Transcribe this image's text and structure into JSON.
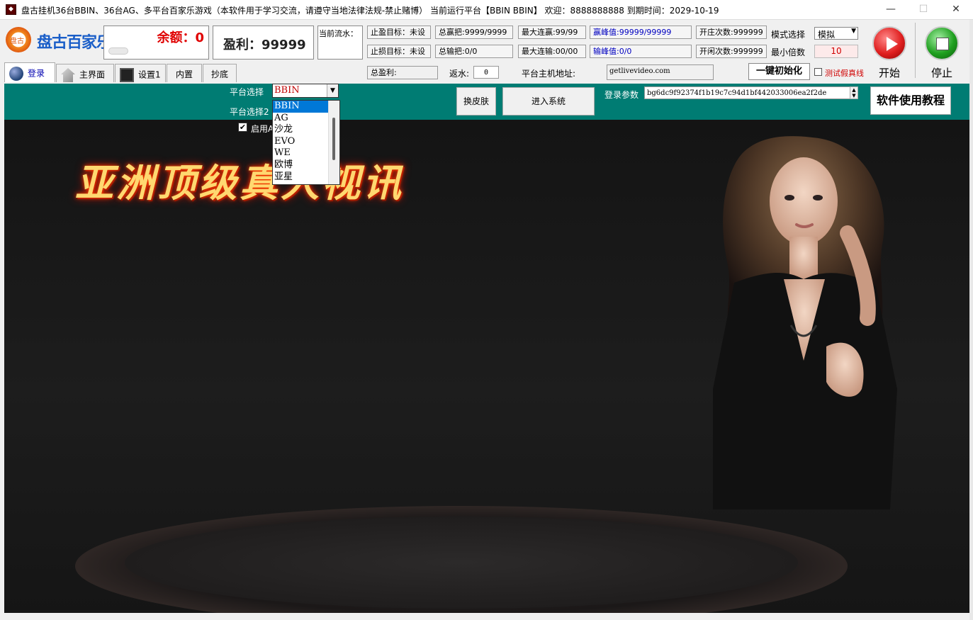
{
  "window": {
    "title": "盘古挂机36台BBIN、36台AG、多平台百家乐游戏（本软件用于学习交流，请遵守当地法律法规-禁止赌博） 当前运行平台【BBIN BBIN】 欢迎：8888888888  到期时间：2029-10-19",
    "min": "—",
    "max": "☐",
    "close": "✕"
  },
  "header": {
    "logo_text": "盘古百家乐",
    "logo_badge": "盘古",
    "balance": "余额：0",
    "profit": "盈利：99999",
    "current_flow_label": "当前流水：",
    "stats": {
      "stop_win_target": "止盈目标：未设",
      "stop_loss_target": "止损目标：未设",
      "total_win": "总赢把:9999/9999",
      "total_lose": "总输把:0/0",
      "max_win_streak": "最大连赢:99/99",
      "max_lose_streak": "最大连输:00/00",
      "win_peak": "赢峰值:99999/99999",
      "lose_peak": "输峰值:0/0",
      "banker_count": "开庄次数:999999",
      "player_count": "开闲次数:999999",
      "mode_label": "模式选择",
      "mode_value": "模拟",
      "min_multiplier_label": "最小倍数",
      "min_multiplier_value": "10",
      "total_profit_label": "总盈利:",
      "rebate_label": "返水:",
      "rebate_value": "0",
      "host_label": "平台主机地址:",
      "host_value": "getlivevideo.com",
      "init_button": "一键初始化",
      "test_fake_label": "测试假真线"
    },
    "start_label": "开始",
    "stop_label": "停止"
  },
  "tabs": [
    {
      "label": "登录",
      "icon": "globe-icon"
    },
    {
      "label": "主界面",
      "icon": "home-icon"
    },
    {
      "label": "设置1",
      "icon": "floppy-icon"
    },
    {
      "label": "内置",
      "icon": ""
    },
    {
      "label": "抄底",
      "icon": ""
    }
  ],
  "login": {
    "platform_label": "平台选择",
    "platform_value": "BBIN",
    "platform2_label": "平台选择2",
    "enable_label": "启用A",
    "skin_button": "换皮肤",
    "enter_button": "进入系统",
    "params_label": "登录参数",
    "params_value": "bg6dc9f92374f1b19c7c94d1bf442033006ea2f2de",
    "tutorial_button": "软件使用教程"
  },
  "dropdown": {
    "options": [
      "BBIN",
      "AG",
      "沙龙",
      "EVO",
      "WE",
      "欧博",
      "亚星"
    ],
    "selected": "BBIN"
  },
  "banner": {
    "text": "亚洲顶级真人视讯"
  },
  "colors": {
    "teal": "#007c73",
    "balance_red": "#e00000",
    "start_red": "#e02020",
    "stop_green": "#20a020"
  }
}
